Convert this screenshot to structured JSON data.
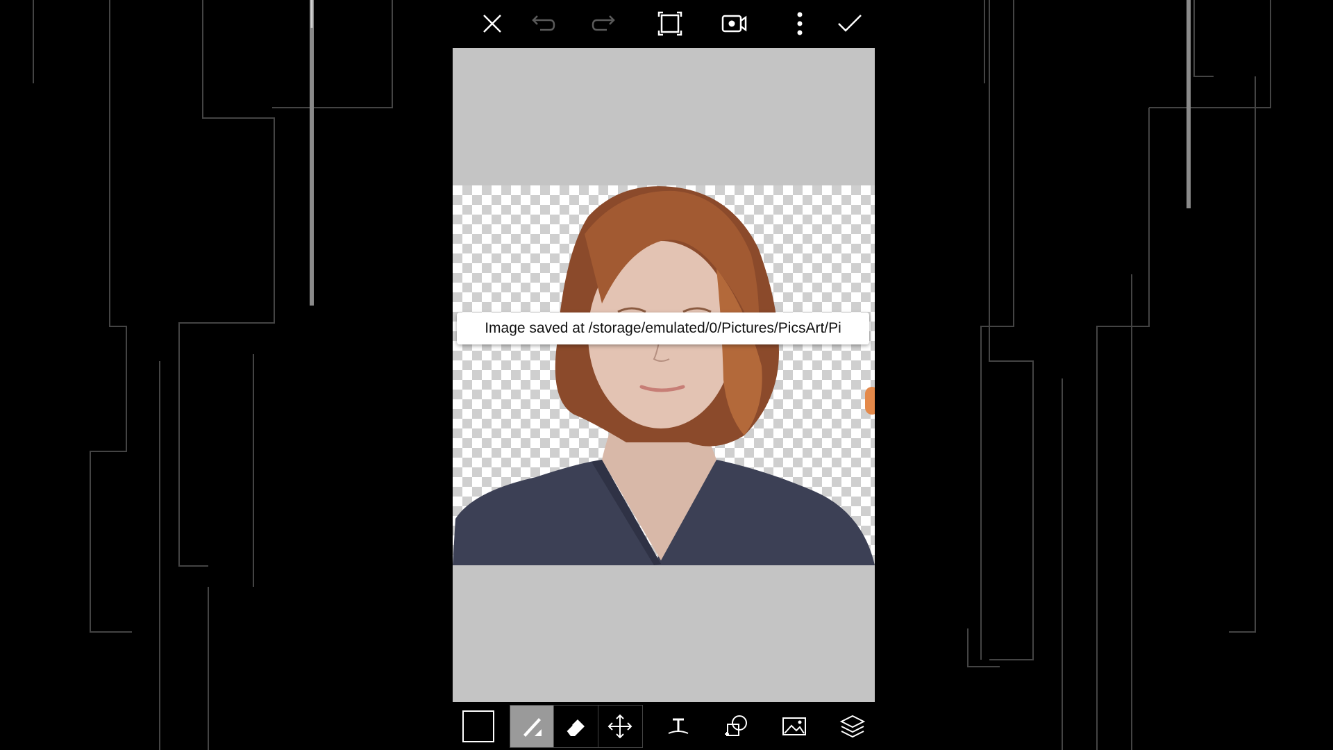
{
  "toolbar": {
    "icons": [
      "close-icon",
      "undo-icon",
      "redo-icon",
      "crop-frame-icon",
      "video-record-icon",
      "more-vertical-icon",
      "check-icon"
    ]
  },
  "toast": {
    "message": "Image saved at /storage/emulated/0/Pictures/PicsArt/Pi"
  },
  "bottom_tools": {
    "icons": [
      "color-swatch",
      "brush-icon",
      "eraser-icon",
      "move-icon",
      "text-icon",
      "shape-select-icon",
      "add-image-icon",
      "layers-icon"
    ],
    "active": "brush-icon"
  },
  "colors": {
    "background": "#000000",
    "canvas": "#c4c4c4",
    "toast_bg": "#ffffff",
    "active_tool": "#9a9a9a"
  }
}
